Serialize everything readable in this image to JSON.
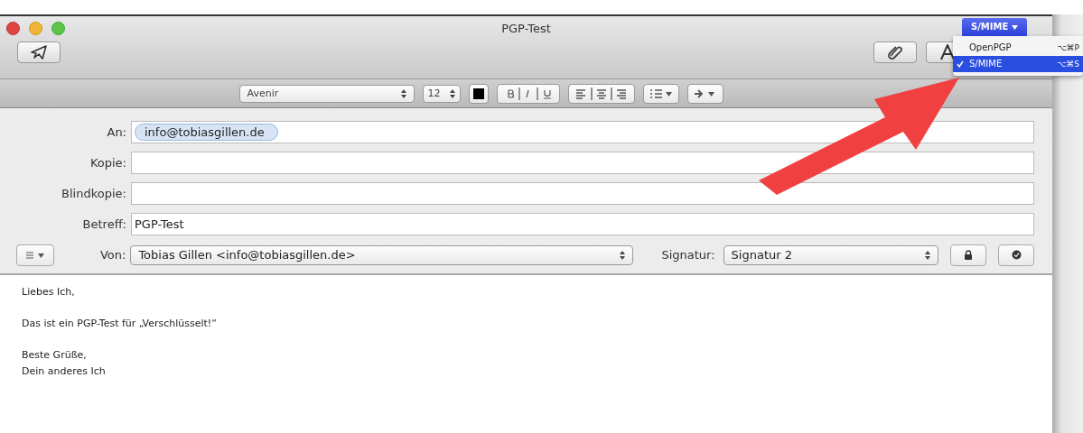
{
  "window": {
    "title": "PGP-Test"
  },
  "format_bar": {
    "font": "Avenir",
    "size": "12"
  },
  "fields": [
    {
      "label": "An:",
      "kind": "recipients",
      "tokens": [
        "info@tobiasgillen.de"
      ]
    },
    {
      "label": "Kopie:",
      "kind": "text"
    },
    {
      "label": "Blindkopie:",
      "kind": "text"
    },
    {
      "label": "Betreff:",
      "kind": "text",
      "value": "PGP-Test"
    }
  ],
  "from": {
    "label": "Von:",
    "value": "Tobias Gillen <info@tobiasgillen.de>"
  },
  "signature": {
    "label": "Signatur:",
    "value": "Signatur 2"
  },
  "security_menu": {
    "button": "S/MIME",
    "items": [
      {
        "label": "OpenPGP",
        "shortcut": "⌥⌘P",
        "selected": false
      },
      {
        "label": "S/MIME",
        "shortcut": "⌥⌘S",
        "selected": true
      }
    ]
  },
  "body": [
    "Liebes Ich,",
    "Das ist ein PGP-Test für „Verschlüsselt!“",
    "Beste Grüße,\nDein anderes Ich"
  ]
}
